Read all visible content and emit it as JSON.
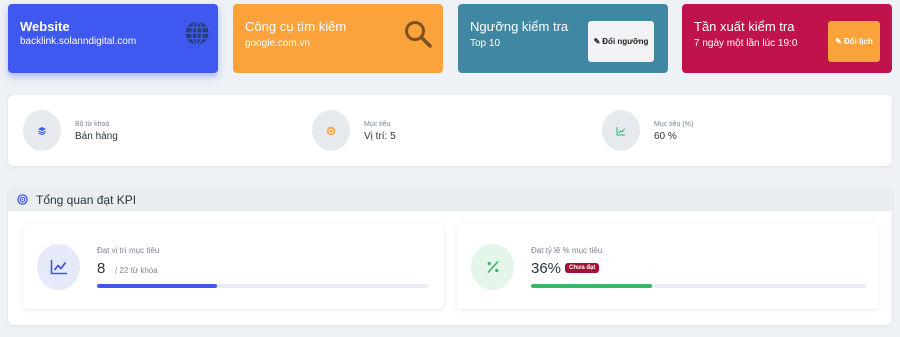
{
  "top_cards": {
    "website": {
      "title": "Website",
      "value": "backlink.solanndigital.com",
      "icon": "globe-icon"
    },
    "search_engine": {
      "title": "Công cụ tìm kiếm",
      "value": "google.com.vn",
      "icon": "search-icon"
    },
    "threshold": {
      "title": "Ngưỡng kiểm tra",
      "value": "Top 10",
      "button_label": "Đổi ngưỡng"
    },
    "frequency": {
      "title": "Tần xuất kiểm tra",
      "value": "7 ngày một lần lúc 19:0",
      "button_label": "Đổi lịch"
    }
  },
  "goals": [
    {
      "label": "Bộ từ khoá",
      "value": "Bán hàng",
      "icon": "layers-icon"
    },
    {
      "label": "Mục tiêu",
      "value": "Vị trí: 5",
      "icon": "target-icon"
    },
    {
      "label": "Mục tiêu (%)",
      "value": "60 %",
      "icon": "chart-line-icon"
    }
  ],
  "kpi": {
    "header": "Tổng quan đạt KPI",
    "position": {
      "label": "Đạt vị trí mục tiêu",
      "value": "8",
      "unit": "/ 22 từ khóa",
      "progress": 0.3636
    },
    "percent": {
      "label": "Đạt tỷ lệ % mục tiêu",
      "value": "36%",
      "badge": "Chưa đạt",
      "progress": 0.36
    }
  },
  "colors": {
    "website_card": "#3f58ef",
    "search_card": "#fba23b",
    "threshold_card": "#3f87a3",
    "frequency_card": "#c0124b",
    "progress_blue": "#3f58ef",
    "progress_green": "#38b768",
    "badge_red": "#a51035"
  }
}
